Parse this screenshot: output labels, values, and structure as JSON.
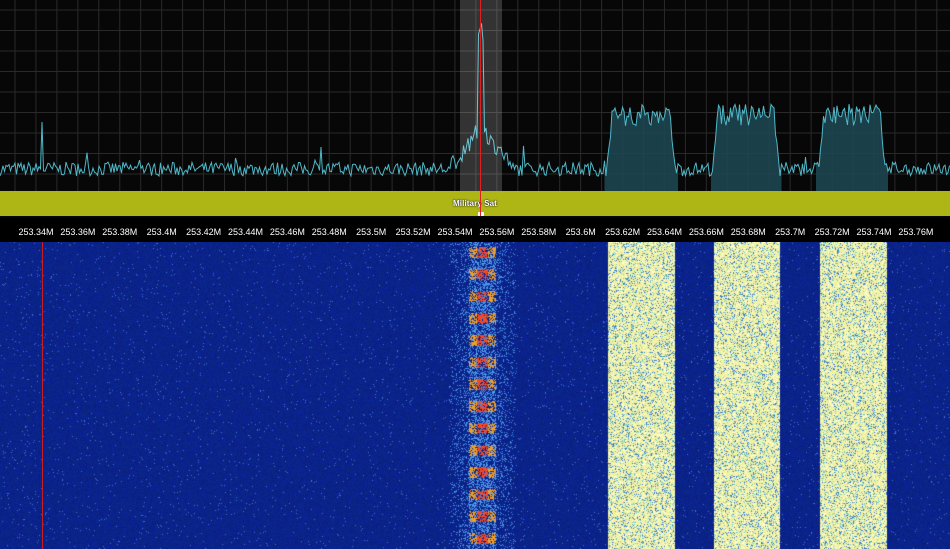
{
  "band": {
    "label": "Military Sat"
  },
  "axis": {
    "unit": "M",
    "ticks": [
      "253.34M",
      "253.36M",
      "253.38M",
      "253.4M",
      "253.42M",
      "253.44M",
      "253.46M",
      "253.48M",
      "253.5M",
      "253.52M",
      "253.54M",
      "253.56M",
      "253.58M",
      "253.6M",
      "253.62M",
      "253.64M",
      "253.66M",
      "253.68M",
      "253.7M",
      "253.72M",
      "253.74M",
      "253.76M"
    ]
  },
  "colors": {
    "spectrum_line": "#4fb8c8",
    "spectrum_fill": "#1e4650",
    "band_overlay": "#aeb615",
    "tuned_marker": "#e02020",
    "waterfall_floor": "#0b1b8f",
    "waterfall_hot": "#f0f0a8"
  },
  "icons": {
    "band_marker": "band-marker-icon"
  }
}
